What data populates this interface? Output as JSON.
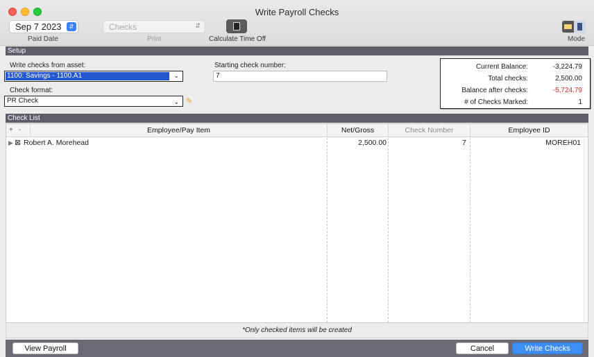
{
  "window": {
    "title": "Write Payroll Checks"
  },
  "toolbar": {
    "date_value": "Sep 7 2023",
    "paid_date_label": "Paid Date",
    "print_select_value": "Checks",
    "print_label": "Print",
    "calc_label": "Calculate Time Off",
    "mode_label": "Mode"
  },
  "setup": {
    "section_title": "Setup",
    "asset_label": "Write checks from asset:",
    "asset_value": "1100: Savings - 1100.A1",
    "format_label": "Check format:",
    "format_value": "PR Check",
    "start_label": "Starting check number:",
    "start_value": "7"
  },
  "summary": {
    "rows": [
      {
        "label": "Current Balance:",
        "value": "-3,224.79"
      },
      {
        "label": "Total checks:",
        "value": "2,500.00"
      },
      {
        "label": "Balance after checks:",
        "value": "-5,724.79"
      },
      {
        "label": "# of Checks Marked:",
        "value": "1"
      }
    ],
    "negative_color": "#e02a2a"
  },
  "checklist": {
    "section_title": "Check List",
    "plus_label": "+",
    "minus_label": "-",
    "columns": [
      "Employee/Pay Item",
      "Net/Gross",
      "Check Number",
      "Employee ID"
    ],
    "rows": [
      {
        "employee": "Robert A. Morehead",
        "net_gross": "2,500.00",
        "check_number": "7",
        "employee_id": "MOREH01"
      }
    ],
    "note": "*Only checked items will be created"
  },
  "footer": {
    "view_payroll_label": "View Payroll",
    "cancel_label": "Cancel",
    "write_checks_label": "Write Checks"
  },
  "icons": {
    "expand": "disclosure-triangle",
    "checkbox": "checked-box",
    "pencil": "pencil",
    "calc": "document",
    "mode": "mode-toggle"
  }
}
